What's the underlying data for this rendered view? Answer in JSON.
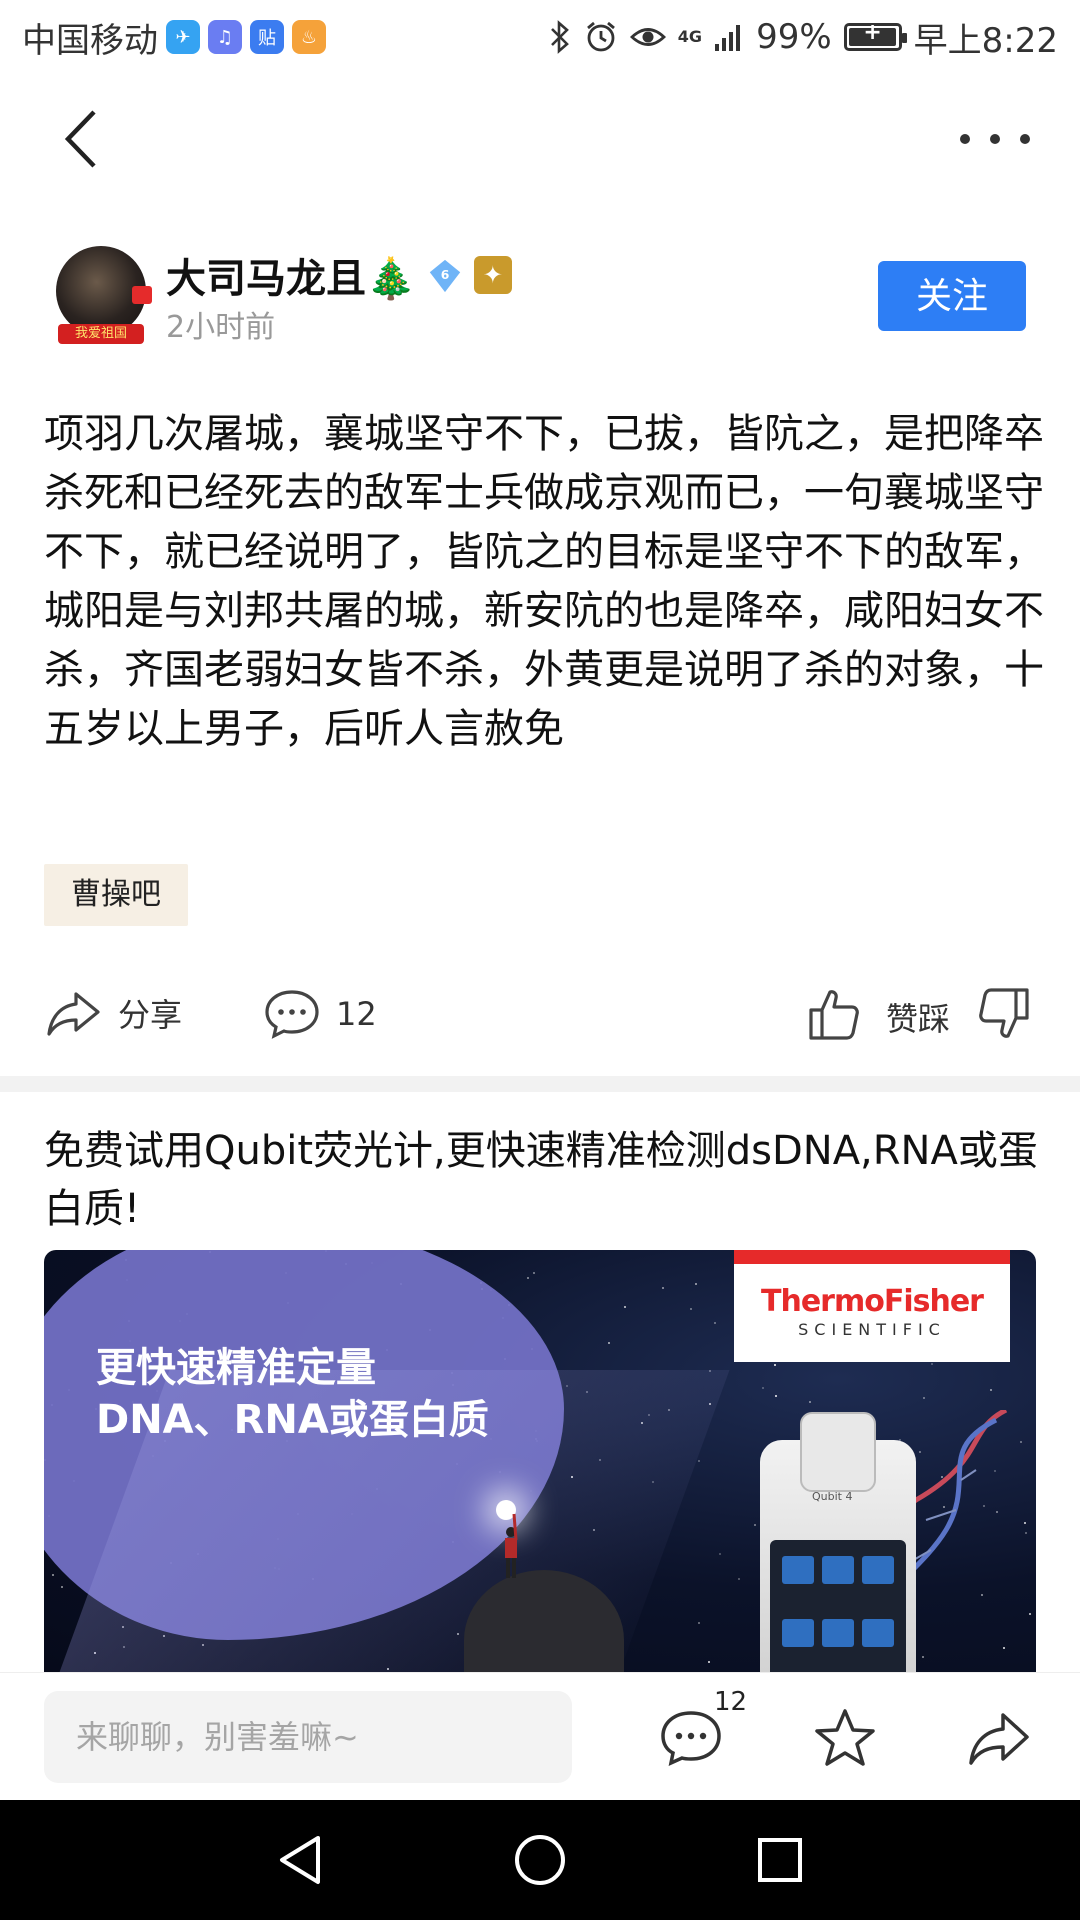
{
  "status_bar": {
    "carrier": "中国移动",
    "apps": [
      {
        "name": "paper-plane-app-icon",
        "color": "#35a3f2",
        "glyph": "✈"
      },
      {
        "name": "music-app-icon",
        "color": "#6a7df2",
        "glyph": "♫"
      },
      {
        "name": "tieba-app-icon",
        "color": "#3b7cf0",
        "glyph": "贴"
      },
      {
        "name": "orange-app-icon",
        "color": "#f5a23a",
        "glyph": "♨"
      }
    ],
    "network": "4G",
    "battery": "99%",
    "battery_level": 0.99,
    "time": "早上8:22"
  },
  "author": {
    "name": "大司马龙且🎄",
    "avatar_badge": "我爱祖国",
    "level": "6",
    "time": "2小时前",
    "follow_label": "关注"
  },
  "post": {
    "content": "项羽几次屠城，襄城坚守不下，已拔，皆阬之，是把降卒杀死和已经死去的敌军士兵做成京观而已，一句襄城坚守不下，就已经说明了，皆阬之的目标是坚守不下的敌军，城阳是与刘邦共屠的城，新安阬的也是降卒，咸阳妇女不杀，齐国老弱妇女皆不杀，外黄更是说明了杀的对象，十五岁以上男子，后听人言赦免",
    "tag": "曹操吧"
  },
  "actions": {
    "share_label": "分享",
    "comment_count": "12",
    "vote_label": "赞踩"
  },
  "ad": {
    "title": "免费试用Qubit荧光计,更快速精准检测dsDNA,RNA或蛋白质!",
    "headline_line1": "更快速精准定量",
    "headline_line2": "DNA、RNA或蛋白质",
    "brand_name": "ThermoFisher",
    "brand_sub": "SCIENTIFIC",
    "device_label": "Qubit 4"
  },
  "bottom_bar": {
    "comment_placeholder": "来聊聊，别害羞嘛~",
    "comment_count": "12"
  },
  "colors": {
    "accent": "#2d7ef5",
    "tag_bg": "#f6efe4",
    "brand_red": "#e62a2a",
    "ad_purple": "#7270c4"
  }
}
